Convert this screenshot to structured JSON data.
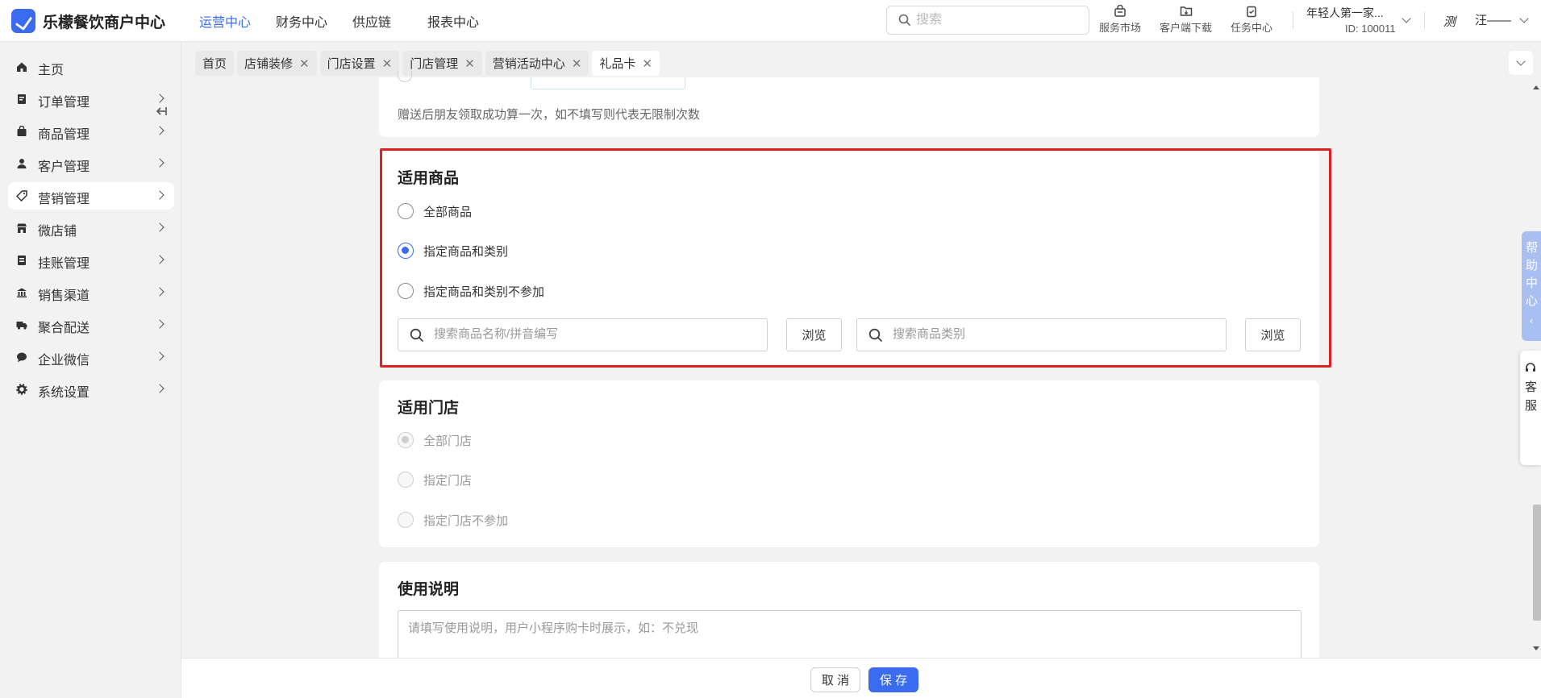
{
  "header": {
    "brand": "乐檬餐饮商户中心",
    "nav": [
      "运营中心",
      "财务中心",
      "供应链",
      "报表中心"
    ],
    "active_nav": 0,
    "search_placeholder": "搜索",
    "tools": [
      {
        "label": "服务市场",
        "icon": "store-bag-icon"
      },
      {
        "label": "客户端下载",
        "icon": "download-folder-icon"
      },
      {
        "label": "任务中心",
        "icon": "task-clipboard-icon"
      }
    ],
    "account_name": "年轻人第一家...",
    "account_id": "ID: 100011",
    "user_name": "汪——",
    "avatar_text": "测"
  },
  "sidebar": {
    "items": [
      {
        "label": "主页",
        "icon": "home-icon"
      },
      {
        "label": "订单管理",
        "icon": "order-icon"
      },
      {
        "label": "商品管理",
        "icon": "goods-icon"
      },
      {
        "label": "客户管理",
        "icon": "customer-icon"
      },
      {
        "label": "营销管理",
        "icon": "tag-icon"
      },
      {
        "label": "微店铺",
        "icon": "shop-icon"
      },
      {
        "label": "挂账管理",
        "icon": "ledger-icon"
      },
      {
        "label": "销售渠道",
        "icon": "bank-icon"
      },
      {
        "label": "聚合配送",
        "icon": "truck-icon"
      },
      {
        "label": "企业微信",
        "icon": "chat-icon"
      },
      {
        "label": "系统设置",
        "icon": "gear-icon"
      }
    ],
    "active_index": 4
  },
  "tabs": [
    {
      "label": "首页",
      "closable": false
    },
    {
      "label": "店铺装修",
      "closable": true
    },
    {
      "label": "门店设置",
      "closable": true
    },
    {
      "label": "门店管理",
      "closable": true
    },
    {
      "label": "营销活动中心",
      "closable": true
    },
    {
      "label": "礼品卡",
      "closable": true,
      "active": true
    }
  ],
  "top_card": {
    "hint": "赠送后朋友领取成功算一次，如不填写则代表无限制次数"
  },
  "goods_section": {
    "title": "适用商品",
    "options": [
      "全部商品",
      "指定商品和类别",
      "指定商品和类别不参加"
    ],
    "selected": 1,
    "product_search_placeholder": "搜索商品名称/拼音编写",
    "category_search_placeholder": "搜索商品类别",
    "browse_label": "浏览"
  },
  "store_section": {
    "title": "适用门店",
    "options": [
      "全部门店",
      "指定门店",
      "指定门店不参加"
    ],
    "selected": 0
  },
  "usage_section": {
    "title": "使用说明",
    "placeholder": "请填写使用说明，用户小程序购卡时展示，如：不兑现"
  },
  "footer": {
    "cancel_label": "取 消",
    "save_label": "保 存"
  },
  "right_widgets": {
    "help_text": "帮助中心",
    "service_text": "客服"
  },
  "colors": {
    "accent": "#3b6cf0",
    "highlight_border": "#e02020",
    "help_tab": "#a9bff2"
  }
}
